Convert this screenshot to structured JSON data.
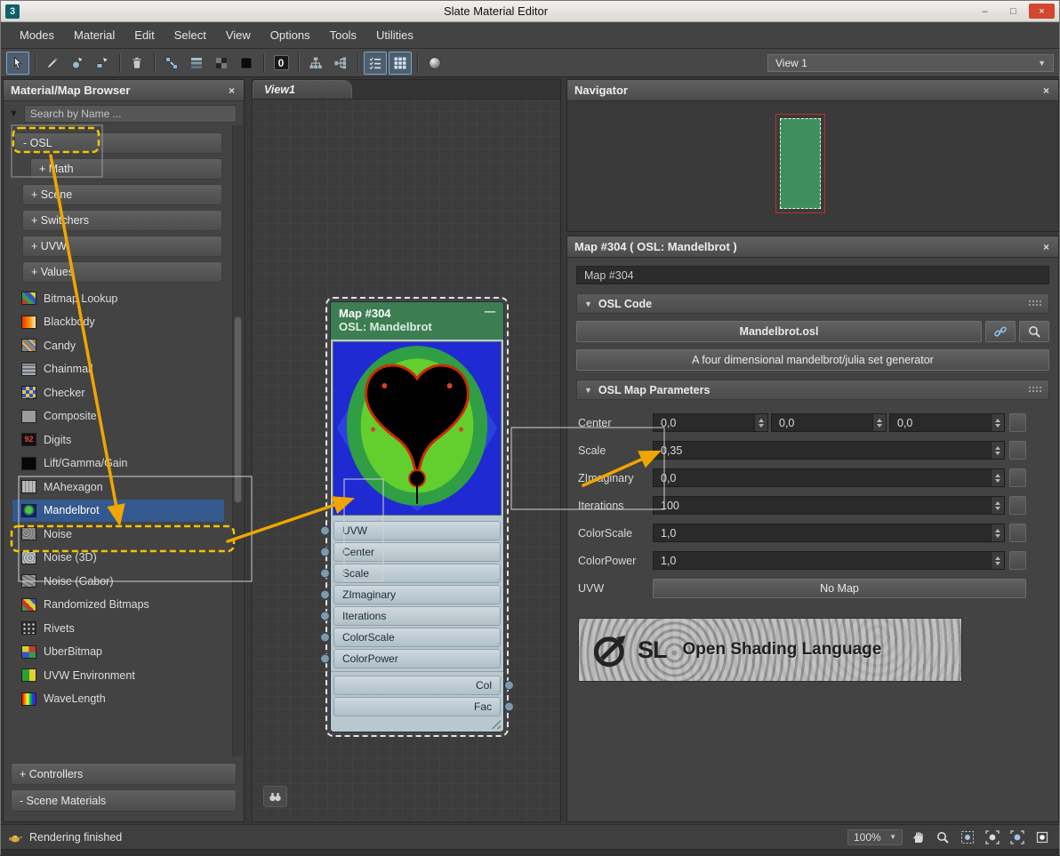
{
  "window": {
    "title": "Slate Material Editor",
    "app_icon_text": "3"
  },
  "glyphs": {
    "caret_down": "▼",
    "close": "×",
    "minimize": "–",
    "maximize": "□",
    "node_minimize": "—",
    "zero": "0",
    "search_filter": "▼"
  },
  "menu": [
    "Modes",
    "Material",
    "Edit",
    "Select",
    "View",
    "Options",
    "Tools",
    "Utilities"
  ],
  "toolbar": {
    "view_selector_label": "View 1"
  },
  "browser": {
    "title": "Material/Map Browser",
    "search_placeholder": "Search by Name ...",
    "tree": [
      {
        "type": "group",
        "label": "- OSL",
        "indent": 0,
        "highlight": true
      },
      {
        "type": "group",
        "label": "+ Math",
        "indent": 2
      },
      {
        "type": "group",
        "label": "+ Scene",
        "indent": 1
      },
      {
        "type": "group",
        "label": "+ Switchers",
        "indent": 1
      },
      {
        "type": "group",
        "label": "+ UVW",
        "indent": 1
      },
      {
        "type": "group",
        "label": "+ Values",
        "indent": 1
      },
      {
        "type": "item",
        "label": "Bitmap Lookup",
        "icon": "bitmap-lookup"
      },
      {
        "type": "item",
        "label": "Blackbody",
        "icon": "blackbody"
      },
      {
        "type": "item",
        "label": "Candy",
        "icon": "candy"
      },
      {
        "type": "item",
        "label": "Chainmail",
        "icon": "chainmail"
      },
      {
        "type": "item",
        "label": "Checker",
        "icon": "checker"
      },
      {
        "type": "item",
        "label": "Composite",
        "icon": "composite"
      },
      {
        "type": "item",
        "label": "Digits",
        "icon": "digits",
        "icon_text": "92"
      },
      {
        "type": "item",
        "label": "Lift/Gamma/Gain",
        "icon": "lift"
      },
      {
        "type": "item",
        "label": "MAhexagon",
        "icon": "mahexagon"
      },
      {
        "type": "item",
        "label": "Mandelbrot",
        "icon": "mandelbrot",
        "selected": true
      },
      {
        "type": "item",
        "label": "Noise",
        "icon": "noise"
      },
      {
        "type": "item",
        "label": "Noise (3D)",
        "icon": "noise3d"
      },
      {
        "type": "item",
        "label": "Noise (Gabor)",
        "icon": "noisegabor"
      },
      {
        "type": "item",
        "label": "Randomized Bitmaps",
        "icon": "randomized"
      },
      {
        "type": "item",
        "label": "Rivets",
        "icon": "rivets"
      },
      {
        "type": "item",
        "label": "UberBitmap",
        "icon": "uberbitmap"
      },
      {
        "type": "item",
        "label": "UVW Environment",
        "icon": "uvwenv"
      },
      {
        "type": "item",
        "label": "WaveLength",
        "icon": "wavelength"
      }
    ],
    "bottom_groups": [
      "+ Controllers",
      "- Scene Materials"
    ]
  },
  "view": {
    "tab_label": "View1"
  },
  "node": {
    "title": "Map #304",
    "subtitle": "OSL: Mandelbrot",
    "inputs": [
      "UVW",
      "Center",
      "Scale",
      "ZImaginary",
      "Iterations",
      "ColorScale",
      "ColorPower"
    ],
    "outputs": [
      "Col",
      "Fac"
    ]
  },
  "navigator": {
    "title": "Navigator"
  },
  "params": {
    "title": "Map #304  ( OSL: Mandelbrot )",
    "name_value": "Map #304",
    "osl_code": {
      "header": "OSL Code",
      "file_button": "Mandelbrot.osl",
      "description": "A four dimensional mandelbrot/julia set generator"
    },
    "map_params": {
      "header": "OSL Map Parameters",
      "rows": [
        {
          "label": "Center",
          "fields": [
            "0,0",
            "0,0",
            "0,0"
          ]
        },
        {
          "label": "Scale",
          "fields": [
            "0,35"
          ]
        },
        {
          "label": "ZImaginary",
          "fields": [
            "0,0"
          ]
        },
        {
          "label": "Iterations",
          "fields": [
            "100"
          ]
        },
        {
          "label": "ColorScale",
          "fields": [
            "1,0"
          ]
        },
        {
          "label": "ColorPower",
          "fields": [
            "1,0"
          ]
        },
        {
          "label": "UVW",
          "map_button": "No Map"
        }
      ]
    },
    "osl_logo": {
      "logo_text": "SL",
      "caption": "Open Shading Language"
    }
  },
  "statusbar": {
    "message": "Rendering finished",
    "zoom": "100%"
  },
  "colors": {
    "selection_blue": "#33598e",
    "annotation_orange": "#f0a500",
    "node_header_green": "#3c7d52"
  }
}
